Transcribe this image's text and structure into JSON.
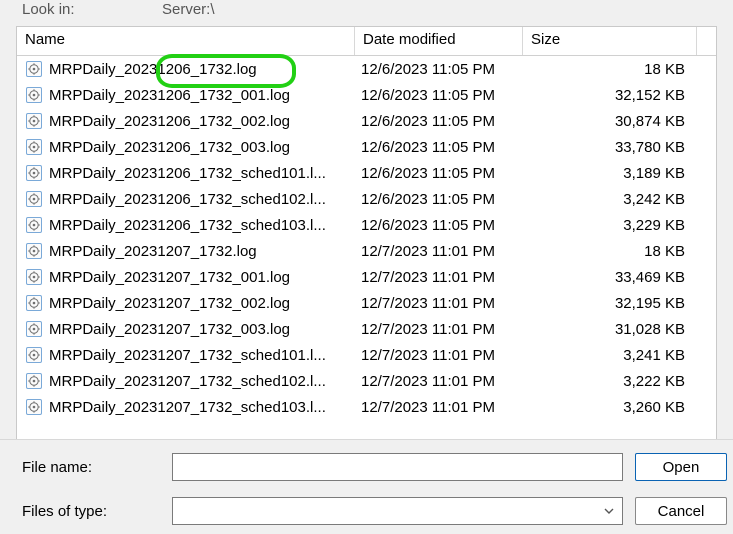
{
  "lookin": {
    "label": "Look in:",
    "value": "Server:\\"
  },
  "headers": {
    "name": "Name",
    "date": "Date modified",
    "size": "Size"
  },
  "files": [
    {
      "name": "MRPDaily_20231206_1732.log",
      "date": "12/6/2023 11:05 PM",
      "size": "18 KB"
    },
    {
      "name": "MRPDaily_20231206_1732_001.log",
      "date": "12/6/2023 11:05 PM",
      "size": "32,152 KB"
    },
    {
      "name": "MRPDaily_20231206_1732_002.log",
      "date": "12/6/2023 11:05 PM",
      "size": "30,874 KB"
    },
    {
      "name": "MRPDaily_20231206_1732_003.log",
      "date": "12/6/2023 11:05 PM",
      "size": "33,780 KB"
    },
    {
      "name": "MRPDaily_20231206_1732_sched101.l...",
      "date": "12/6/2023 11:05 PM",
      "size": "3,189 KB"
    },
    {
      "name": "MRPDaily_20231206_1732_sched102.l...",
      "date": "12/6/2023 11:05 PM",
      "size": "3,242 KB"
    },
    {
      "name": "MRPDaily_20231206_1732_sched103.l...",
      "date": "12/6/2023 11:05 PM",
      "size": "3,229 KB"
    },
    {
      "name": "MRPDaily_20231207_1732.log",
      "date": "12/7/2023 11:01 PM",
      "size": "18 KB"
    },
    {
      "name": "MRPDaily_20231207_1732_001.log",
      "date": "12/7/2023 11:01 PM",
      "size": "33,469 KB"
    },
    {
      "name": "MRPDaily_20231207_1732_002.log",
      "date": "12/7/2023 11:01 PM",
      "size": "32,195 KB"
    },
    {
      "name": "MRPDaily_20231207_1732_003.log",
      "date": "12/7/2023 11:01 PM",
      "size": "31,028 KB"
    },
    {
      "name": "MRPDaily_20231207_1732_sched101.l...",
      "date": "12/7/2023 11:01 PM",
      "size": "3,241 KB"
    },
    {
      "name": "MRPDaily_20231207_1732_sched102.l...",
      "date": "12/7/2023 11:01 PM",
      "size": "3,222 KB"
    },
    {
      "name": "MRPDaily_20231207_1732_sched103.l...",
      "date": "12/7/2023 11:01 PM",
      "size": "3,260 KB"
    }
  ],
  "form": {
    "filename_label": "File name:",
    "filename_value": "",
    "filetype_label": "Files of type:",
    "filetype_value": ""
  },
  "buttons": {
    "open": "Open",
    "cancel": "Cancel"
  }
}
